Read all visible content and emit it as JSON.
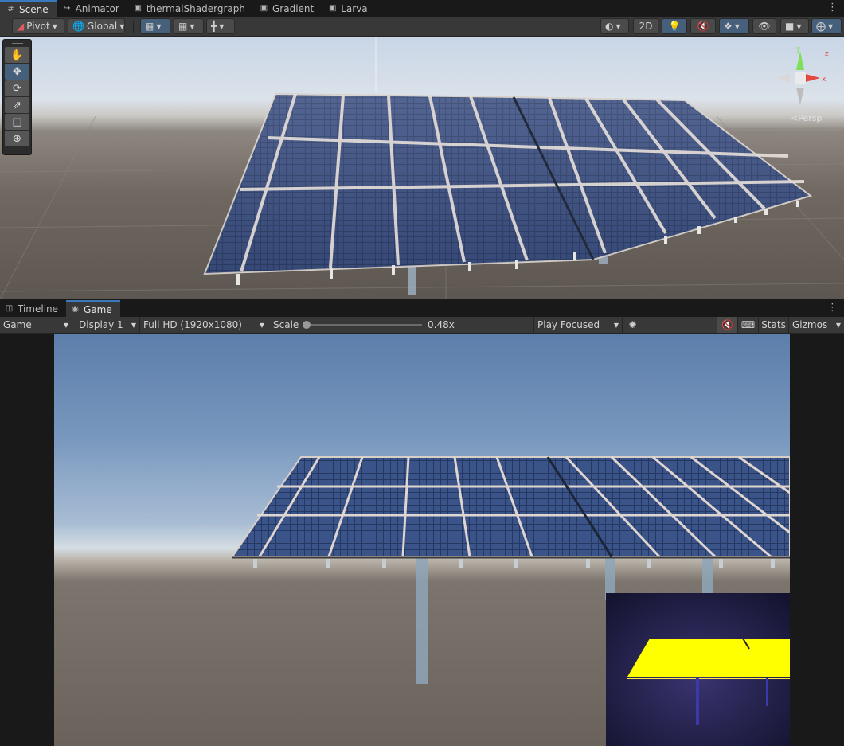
{
  "top_tabs": [
    {
      "label": "Scene",
      "icon": "grid-icon"
    },
    {
      "label": "Animator",
      "icon": "animator-icon"
    },
    {
      "label": "thermalShadergraph",
      "icon": "shadergraph-icon"
    },
    {
      "label": "Gradient",
      "icon": "shadergraph-icon"
    },
    {
      "label": "Larva",
      "icon": "shadergraph-icon"
    }
  ],
  "scene_toolbar": {
    "pivot": "Pivot",
    "global": "Global",
    "mode_2d": "2D"
  },
  "scene_view": {
    "persp_label": "<Persp",
    "gizmo_axes": {
      "x": "x",
      "y": "y",
      "z": "z"
    }
  },
  "bottom_tabs": [
    {
      "label": "Timeline",
      "icon": "timeline-icon"
    },
    {
      "label": "Game",
      "icon": "gamepad-icon"
    }
  ],
  "game_toolbar": {
    "view": "Game",
    "display": "Display 1",
    "resolution": "Full HD (1920x1080)",
    "scale_label": "Scale",
    "scale_value": "0.48x",
    "scale_fraction": 0.0,
    "play_mode": "Play Focused",
    "stats": "Stats",
    "gizmos": "Gizmos"
  },
  "colors": {
    "accent": "#3a79bb",
    "toggle_active": "#46607c",
    "panel": "#383838",
    "thermal_hot": "#ffff00",
    "thermal_bg": "#191935"
  }
}
